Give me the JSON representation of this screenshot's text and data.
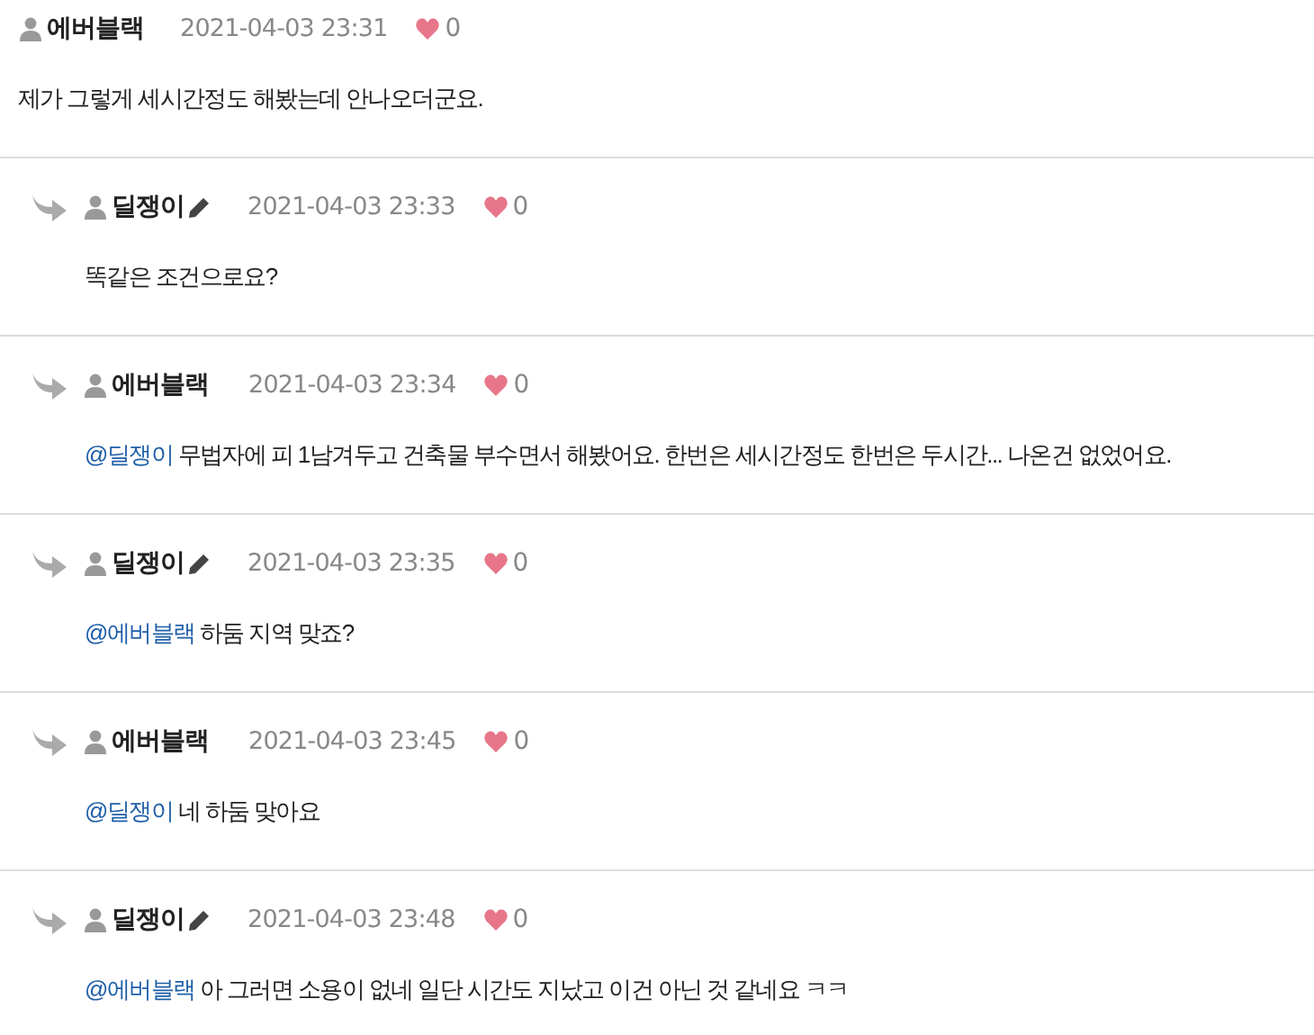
{
  "comments": [
    {
      "kind": "comment",
      "author": "에버블랙",
      "pencil": false,
      "date": "2021-04-03 23:31",
      "likes": "0",
      "body": "제가 그렇게 세시간정도 해봤는데 안나오더군요."
    },
    {
      "kind": "reply",
      "author": "딜쟁이",
      "pencil": true,
      "date": "2021-04-03 23:33",
      "likes": "0",
      "body": "똑같은 조건으로요?"
    },
    {
      "kind": "reply",
      "author": "에버블랙",
      "pencil": false,
      "date": "2021-04-03 23:34",
      "likes": "0",
      "mention": "@딜쟁이",
      "body": "무법자에 피 1남겨두고 건축물 부수면서 해봤어요. 한번은 세시간정도 한번은 두시간... 나온건 없었어요."
    },
    {
      "kind": "reply",
      "author": "딜쟁이",
      "pencil": true,
      "date": "2021-04-03 23:35",
      "likes": "0",
      "mention": "@에버블랙",
      "body": "하둠 지역 맞죠?"
    },
    {
      "kind": "reply",
      "author": "에버블랙",
      "pencil": false,
      "date": "2021-04-03 23:45",
      "likes": "0",
      "mention": "@딜쟁이",
      "body": "네 하둠 맞아요"
    },
    {
      "kind": "reply",
      "author": "딜쟁이",
      "pencil": true,
      "date": "2021-04-03 23:48",
      "likes": "0",
      "mention": "@에버블랙",
      "body": "아 그러면 소용이 없네 일단 시간도 지났고 이건 아닌 것 같네요 ㅋㅋ"
    }
  ]
}
